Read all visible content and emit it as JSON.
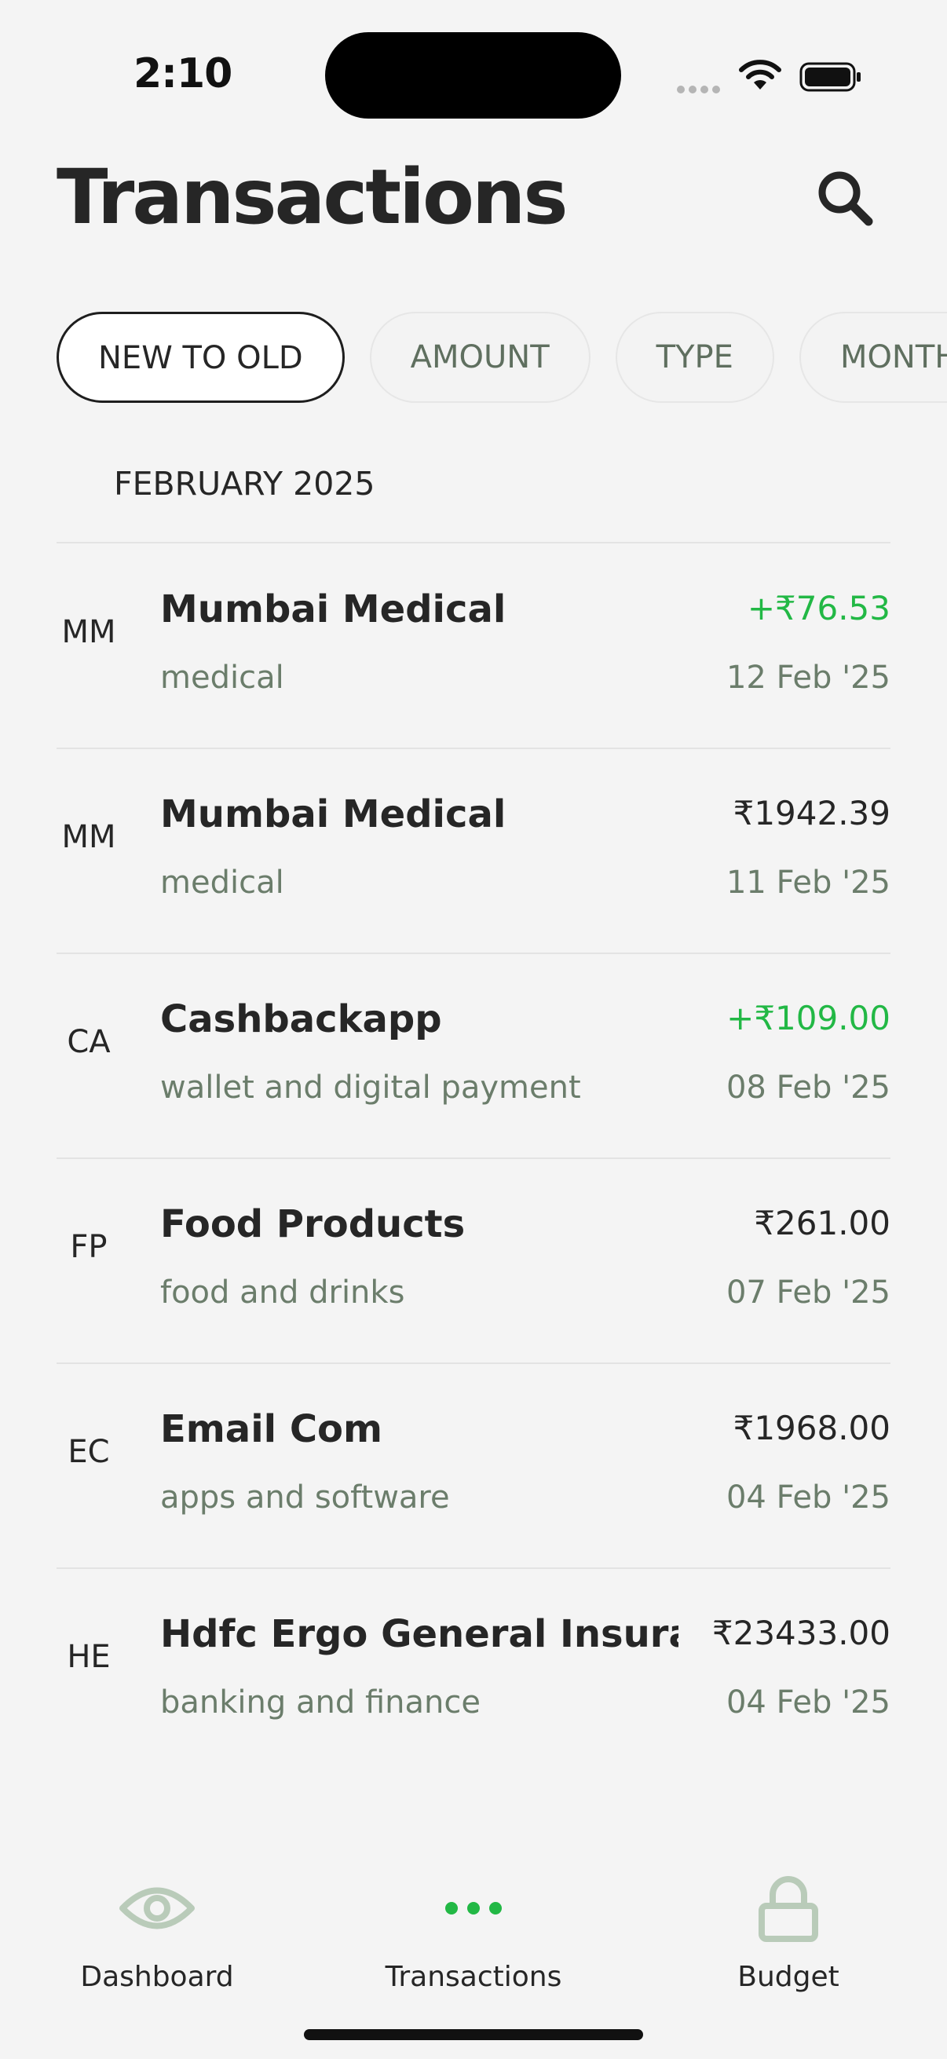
{
  "status": {
    "time": "2:10"
  },
  "header": {
    "title": "Transactions"
  },
  "filters": [
    "NEW TO OLD",
    "AMOUNT",
    "TYPE",
    "MONTH"
  ],
  "month": "FEBRUARY 2025",
  "transactions": [
    {
      "initials": "MM",
      "name": "Mumbai Medical",
      "category": "medical",
      "amount": "+₹76.53",
      "credit": true,
      "date": "12 Feb '25"
    },
    {
      "initials": "MM",
      "name": "Mumbai Medical",
      "category": "medical",
      "amount": "₹1942.39",
      "credit": false,
      "date": "11 Feb '25"
    },
    {
      "initials": "CA",
      "name": "Cashbackapp",
      "category": "wallet and digital payment",
      "amount": "+₹109.00",
      "credit": true,
      "date": "08 Feb '25"
    },
    {
      "initials": "FP",
      "name": "Food Products",
      "category": "food and drinks",
      "amount": "₹261.00",
      "credit": false,
      "date": "07 Feb '25"
    },
    {
      "initials": "EC",
      "name": "Email Com",
      "category": "apps and software",
      "amount": "₹1968.00",
      "credit": false,
      "date": "04 Feb '25"
    },
    {
      "initials": "HE",
      "name": "Hdfc Ergo General Insuran...",
      "category": "banking and finance",
      "amount": "₹23433.00",
      "credit": false,
      "date": "04 Feb '25"
    }
  ],
  "nav": {
    "dashboard": {
      "label": "Dashboard",
      "icon": "eye-icon"
    },
    "transactions": {
      "label": "Transactions",
      "icon": "more-dots-icon"
    },
    "budget": {
      "label": "Budget",
      "icon": "lock-icon"
    }
  },
  "colors": {
    "credit": "#22b845",
    "muted": "#6b7d6b",
    "nav_icon": "#b9cbb9",
    "active_nav_icon": "#22b845"
  }
}
